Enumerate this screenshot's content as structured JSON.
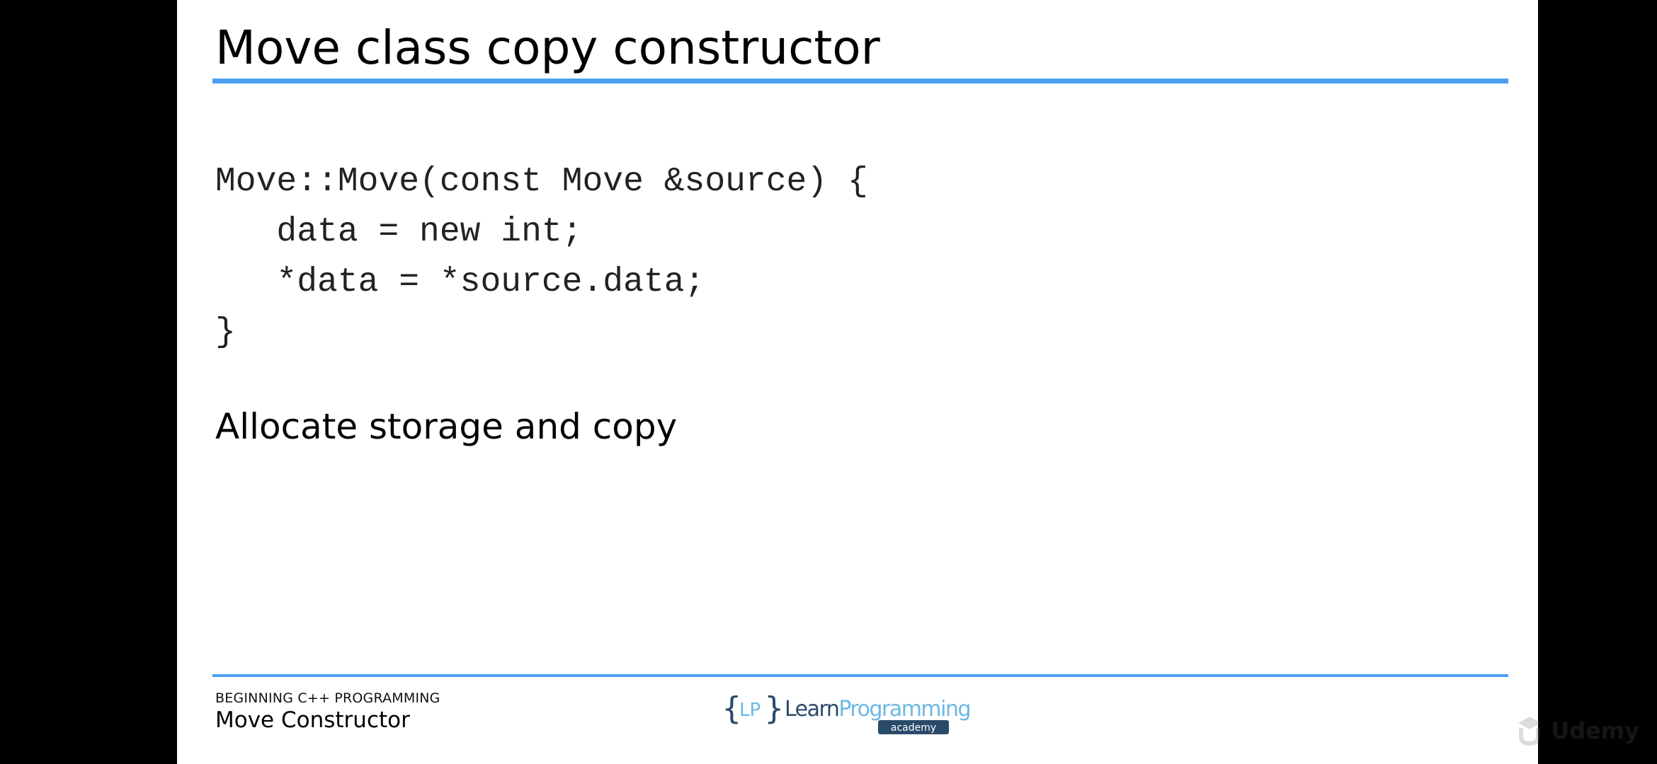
{
  "slide": {
    "title": "Move class copy constructor",
    "code_lines": [
      "Move::Move(const Move &source) {",
      "   data = new int;",
      "   *data = *source.data;",
      "}"
    ],
    "body_text": "Allocate storage and copy"
  },
  "footer": {
    "course": "BEGINNING C++ PROGRAMMING",
    "topic": "Move Constructor",
    "logo_text": "LearnProgramming",
    "logo_sub": "academy"
  },
  "watermark": {
    "text": "Udemy"
  },
  "colors": {
    "accent": "#4a9ff0",
    "logo_blue": "#6ab8e6",
    "logo_navy": "#2a4a6a",
    "slide_bg": "#ffffff",
    "frame_bg": "#000000"
  }
}
